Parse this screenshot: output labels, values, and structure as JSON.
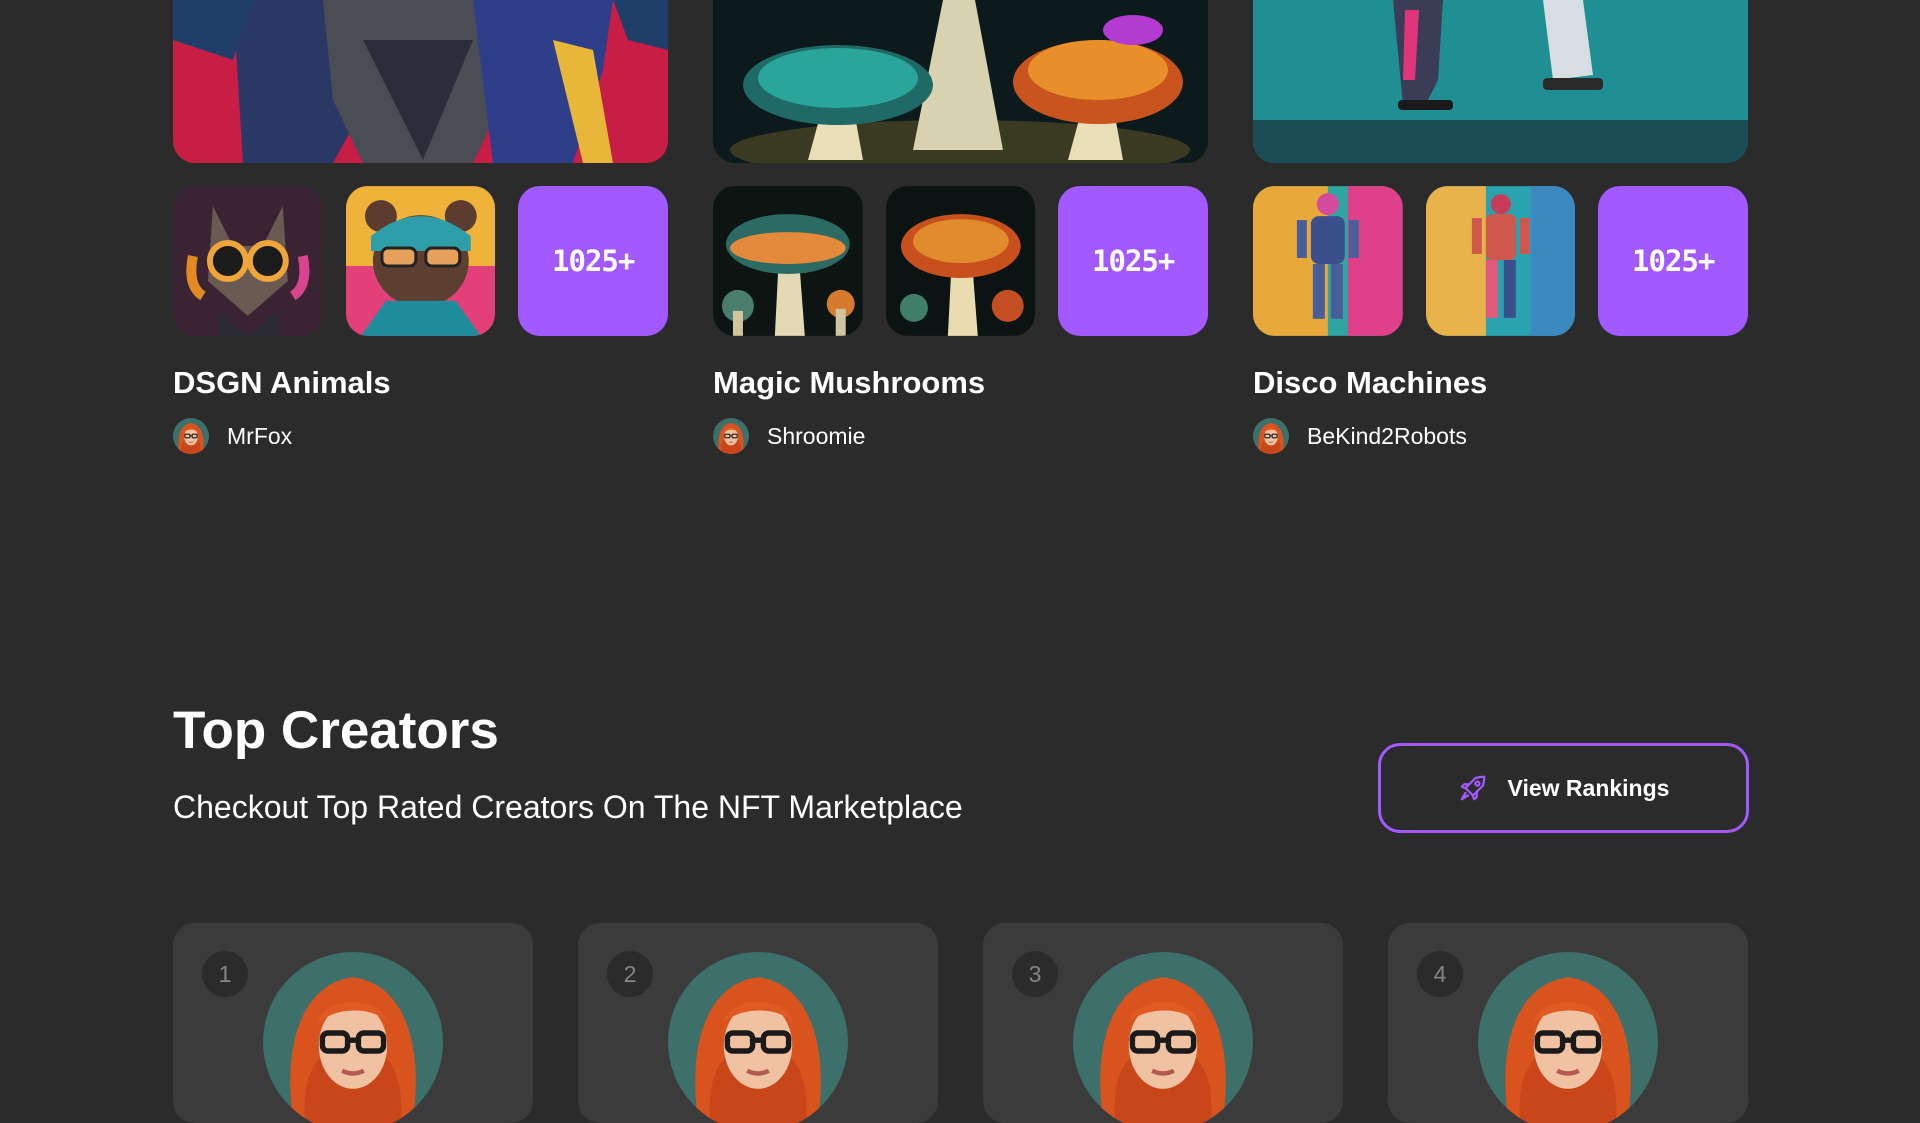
{
  "collections": [
    {
      "title": "DSGN Animals",
      "more_count": "1025+",
      "artist": "MrFox"
    },
    {
      "title": "Magic Mushrooms",
      "more_count": "1025+",
      "artist": "Shroomie"
    },
    {
      "title": "Disco Machines",
      "more_count": "1025+",
      "artist": "BeKind2Robots"
    }
  ],
  "top_creators": {
    "title": "Top Creators",
    "subtitle": "Checkout Top Rated Creators On The NFT Marketplace",
    "button_label": "View Rankings",
    "button_icon": "rocket-icon",
    "cards": [
      {
        "rank": "1"
      },
      {
        "rank": "2"
      },
      {
        "rank": "3"
      },
      {
        "rank": "4"
      }
    ]
  },
  "colors": {
    "background": "#2b2b2b",
    "card": "#3b3b3b",
    "accent": "#a259ff",
    "muted": "#858584"
  }
}
